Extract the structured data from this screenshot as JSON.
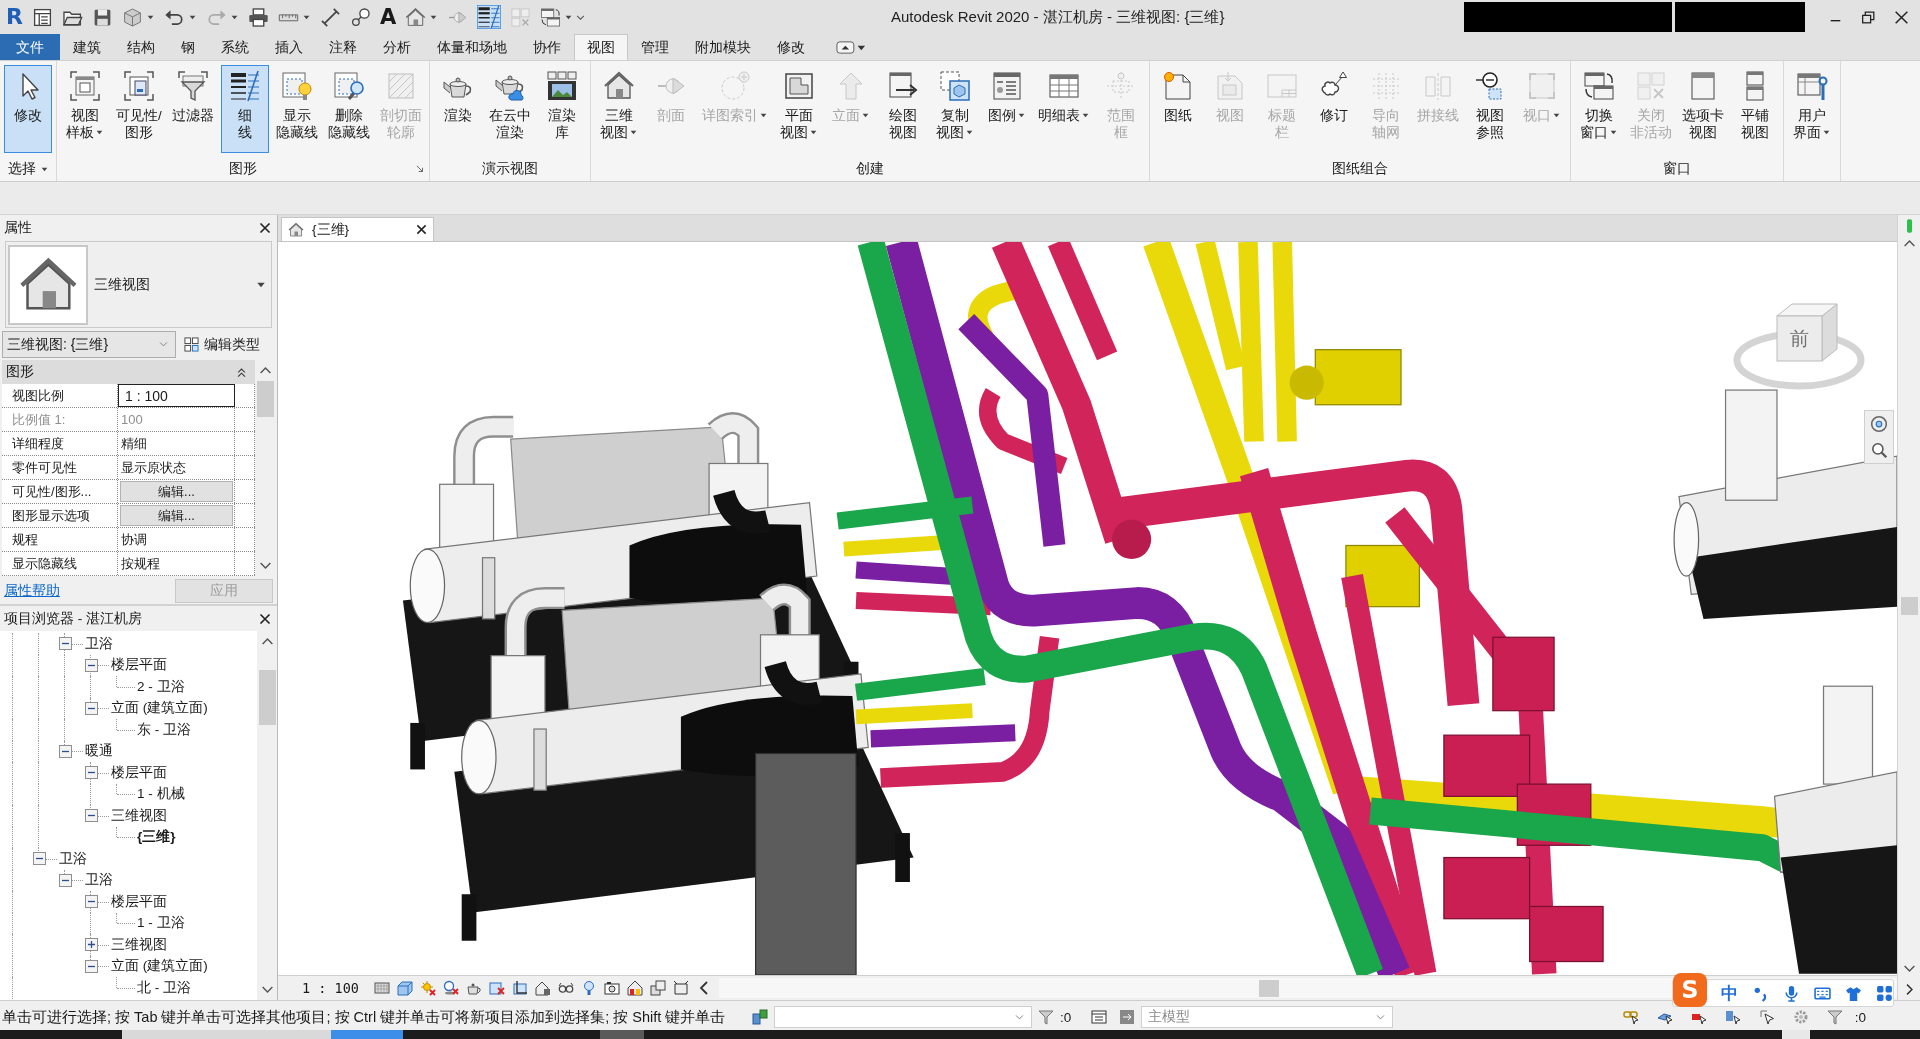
{
  "window": {
    "logo": "R",
    "title": "Autodesk Revit 2020 - 湛江机房 - 三维视图: {三维}"
  },
  "quick_access": {
    "text_tool": "A"
  },
  "menu_tabs": [
    {
      "label": "文件",
      "kind": "application",
      "selected": false
    },
    {
      "label": "建筑",
      "kind": "tab",
      "selected": false
    },
    {
      "label": "结构",
      "kind": "tab",
      "selected": false
    },
    {
      "label": "钢",
      "kind": "tab",
      "selected": false
    },
    {
      "label": "系统",
      "kind": "tab",
      "selected": false
    },
    {
      "label": "插入",
      "kind": "tab",
      "selected": false
    },
    {
      "label": "注释",
      "kind": "tab",
      "selected": false
    },
    {
      "label": "分析",
      "kind": "tab",
      "selected": false
    },
    {
      "label": "体量和场地",
      "kind": "tab",
      "selected": false
    },
    {
      "label": "协作",
      "kind": "tab",
      "selected": false
    },
    {
      "label": "视图",
      "kind": "tab",
      "selected": true
    },
    {
      "label": "管理",
      "kind": "tab",
      "selected": false
    },
    {
      "label": "附加模块",
      "kind": "tab",
      "selected": false
    },
    {
      "label": "修改",
      "kind": "tab",
      "selected": false
    }
  ],
  "ribbon": {
    "panels": [
      {
        "label": "选择",
        "dropdown": true,
        "buttons": [
          {
            "lines": [
              "修改"
            ],
            "active": true,
            "disabled": false,
            "dropdown": false
          }
        ]
      },
      {
        "label": "图形",
        "launcher": true,
        "buttons": [
          {
            "lines": [
              "视图",
              "样板"
            ],
            "active": false,
            "disabled": false,
            "dropdown": true
          },
          {
            "lines": [
              "可见性/",
              "图形"
            ],
            "active": false,
            "disabled": false,
            "dropdown": false
          },
          {
            "lines": [
              "过滤器"
            ],
            "active": false,
            "disabled": false,
            "dropdown": false
          },
          {
            "lines": [
              "细",
              "线"
            ],
            "active": true,
            "disabled": false,
            "dropdown": false
          },
          {
            "lines": [
              "显示",
              "隐藏线"
            ],
            "active": false,
            "disabled": false,
            "dropdown": false
          },
          {
            "lines": [
              "删除",
              "隐藏线"
            ],
            "active": false,
            "disabled": false,
            "dropdown": false
          },
          {
            "lines": [
              "剖切面",
              "轮廓"
            ],
            "active": false,
            "disabled": true,
            "dropdown": false
          }
        ]
      },
      {
        "label": "演示视图",
        "buttons": [
          {
            "lines": [
              "渲染"
            ],
            "active": false,
            "disabled": false,
            "dropdown": false
          },
          {
            "lines": [
              "在云中",
              "渲染"
            ],
            "active": false,
            "disabled": false,
            "dropdown": false
          },
          {
            "lines": [
              "渲染",
              "库"
            ],
            "active": false,
            "disabled": false,
            "dropdown": false
          }
        ]
      },
      {
        "label": "创建",
        "buttons": [
          {
            "lines": [
              "三维",
              "视图"
            ],
            "active": false,
            "disabled": false,
            "dropdown": true
          },
          {
            "lines": [
              "剖面"
            ],
            "active": false,
            "disabled": true,
            "dropdown": false
          },
          {
            "lines": [
              "详图索引"
            ],
            "active": false,
            "disabled": true,
            "dropdown": true
          },
          {
            "lines": [
              "平面",
              "视图"
            ],
            "active": false,
            "disabled": false,
            "dropdown": true
          },
          {
            "lines": [
              "立面"
            ],
            "active": false,
            "disabled": true,
            "dropdown": true
          },
          {
            "lines": [
              "绘图",
              "视图"
            ],
            "active": false,
            "disabled": false,
            "dropdown": false
          },
          {
            "lines": [
              "复制",
              "视图"
            ],
            "active": false,
            "disabled": false,
            "dropdown": true
          },
          {
            "lines": [
              "图例"
            ],
            "active": false,
            "disabled": false,
            "dropdown": true
          },
          {
            "lines": [
              "明细表"
            ],
            "active": false,
            "disabled": false,
            "dropdown": true
          },
          {
            "lines": [
              "范围",
              "框"
            ],
            "active": false,
            "disabled": true,
            "dropdown": false
          }
        ]
      },
      {
        "label": "图纸组合",
        "buttons": [
          {
            "lines": [
              "图纸"
            ],
            "active": false,
            "disabled": false,
            "dropdown": false
          },
          {
            "lines": [
              "视图"
            ],
            "active": false,
            "disabled": true,
            "dropdown": false
          },
          {
            "lines": [
              "标题",
              "栏"
            ],
            "active": false,
            "disabled": true,
            "dropdown": false
          },
          {
            "lines": [
              "修订"
            ],
            "active": false,
            "disabled": false,
            "dropdown": false
          },
          {
            "lines": [
              "导向",
              "轴网"
            ],
            "active": false,
            "disabled": true,
            "dropdown": false
          },
          {
            "lines": [
              "拼接线"
            ],
            "active": false,
            "disabled": true,
            "dropdown": false
          },
          {
            "lines": [
              "视图",
              "参照"
            ],
            "active": false,
            "disabled": false,
            "dropdown": false
          },
          {
            "lines": [
              "视口"
            ],
            "active": false,
            "disabled": true,
            "dropdown": true
          }
        ]
      },
      {
        "label": "窗口",
        "buttons": [
          {
            "lines": [
              "切换",
              "窗口"
            ],
            "active": false,
            "disabled": false,
            "dropdown": true
          },
          {
            "lines": [
              "关闭",
              "非活动"
            ],
            "active": false,
            "disabled": true,
            "dropdown": false
          },
          {
            "lines": [
              "选项卡",
              "视图"
            ],
            "active": false,
            "disabled": false,
            "dropdown": false
          },
          {
            "lines": [
              "平铺",
              "视图"
            ],
            "active": false,
            "disabled": false,
            "dropdown": false
          }
        ]
      },
      {
        "buttons": [
          {
            "lines": [
              "用户",
              "界面"
            ],
            "active": false,
            "disabled": false,
            "dropdown": true
          }
        ]
      }
    ]
  },
  "properties": {
    "title": "属性",
    "type_name": "三维视图",
    "instance_selector": "三维视图: {三维}",
    "edit_type": "编辑类型",
    "group": "图形",
    "rows": [
      {
        "label": "视图比例",
        "value": "1 : 100",
        "kind": "input",
        "disabled": false
      },
      {
        "label": "比例值 1:",
        "value": "100",
        "kind": "text",
        "disabled": true
      },
      {
        "label": "详细程度",
        "value": "精细",
        "kind": "text",
        "disabled": false
      },
      {
        "label": "零件可见性",
        "value": "显示原状态",
        "kind": "text",
        "disabled": false
      },
      {
        "label": "可见性/图形...",
        "value": "编辑...",
        "kind": "button",
        "disabled": false
      },
      {
        "label": "图形显示选项",
        "value": "编辑...",
        "kind": "button",
        "disabled": false
      },
      {
        "label": "规程",
        "value": "协调",
        "kind": "text",
        "disabled": false
      },
      {
        "label": "显示隐藏线",
        "value": "按规程",
        "kind": "text",
        "disabled": false
      }
    ],
    "help_link": "属性帮助",
    "apply_button": {
      "label": "应用",
      "disabled": true
    }
  },
  "project_browser": {
    "title": "项目浏览器 - 湛江机房",
    "tree": [
      {
        "children": [
          {
            "children": [
              {
                "label": "卫浴",
                "expanded": true,
                "children": [
                  {
                    "label": "楼层平面",
                    "expanded": true,
                    "children": [
                      {
                        "label": "2 - 卫浴",
                        "current": false
                      }
                    ]
                  },
                  {
                    "label": "立面 (建筑立面)",
                    "expanded": true,
                    "children": [
                      {
                        "label": "东 - 卫浴",
                        "current": false
                      }
                    ]
                  }
                ]
              },
              {
                "label": "暖通",
                "expanded": true,
                "children": [
                  {
                    "label": "楼层平面",
                    "expanded": true,
                    "children": [
                      {
                        "label": "1 - 机械",
                        "current": false
                      }
                    ]
                  },
                  {
                    "label": "三维视图",
                    "expanded": true,
                    "children": [
                      {
                        "label": "{三维}",
                        "current": true
                      }
                    ]
                  }
                ]
              }
            ]
          },
          {
            "label": "卫浴",
            "expanded": true,
            "children": [
              {
                "label": "卫浴",
                "expanded": true,
                "children": [
                  {
                    "label": "楼层平面",
                    "expanded": true,
                    "children": [
                      {
                        "label": "1 - 卫浴",
                        "current": false
                      }
                    ]
                  },
                  {
                    "label": "三维视图",
                    "expanded": false
                  },
                  {
                    "label": "立面 (建筑立面)",
                    "expanded": true,
                    "children": [
                      {
                        "label": "北 - 卫浴",
                        "current": false
                      }
                    ]
                  }
                ]
              }
            ]
          }
        ]
      }
    ]
  },
  "view_tabs": [
    {
      "label": "{三维}",
      "selected": true
    }
  ],
  "view_cube": {
    "face": "前"
  },
  "view_control_bar": {
    "scale": "1 : 100"
  },
  "status_bar": {
    "hint": "单击可进行选择; 按 Tab 键并单击可选择其他项目; 按 Ctrl 键并单击可将新项目添加到选择集; 按 Shift 键并单击",
    "filter_count": ":0",
    "design_option": {
      "value": "主模型",
      "disabled": true
    },
    "selection_count": ":0"
  },
  "ime_toolbar": {
    "logo": "S",
    "mode": "中"
  }
}
